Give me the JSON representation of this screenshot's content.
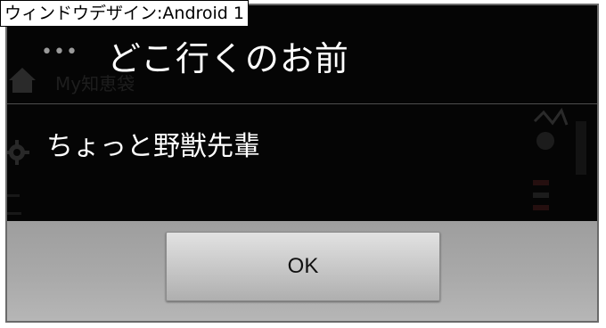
{
  "window": {
    "label": "ウィンドウデザイン:Android 1"
  },
  "dialog": {
    "title": "どこ行くのお前",
    "message": "ちょっと野獣先輩",
    "ok_label": "OK"
  },
  "background": {
    "menu_glyph": "•••",
    "title_fragment": "My知恵袋",
    "icons": [
      "home-icon",
      "gear-icon"
    ]
  },
  "colors": {
    "dialog_bg": "#050505",
    "button_bar": "#a9a9a9",
    "text": "#ffffff"
  }
}
